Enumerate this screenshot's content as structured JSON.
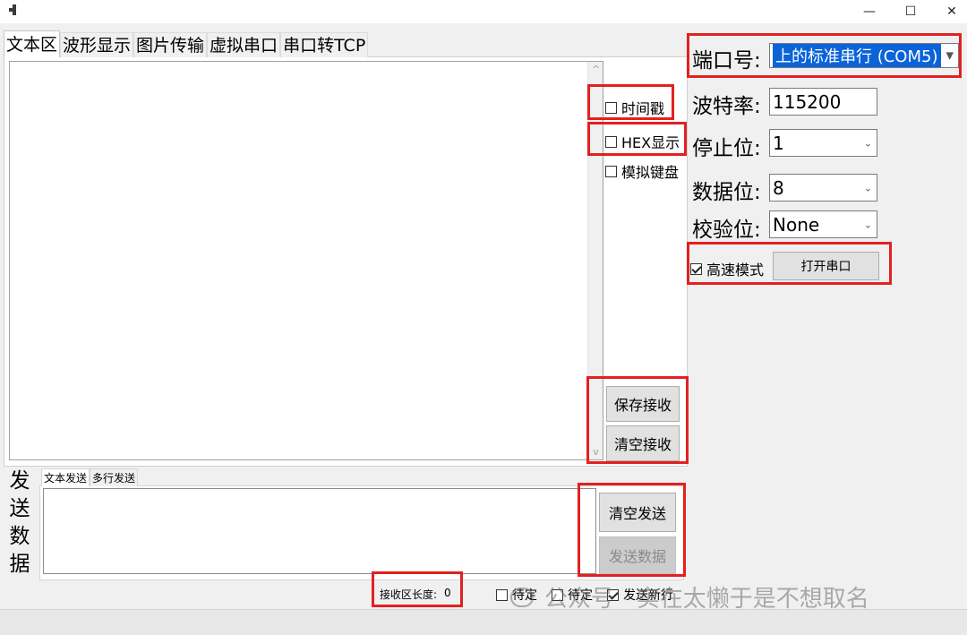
{
  "window": {
    "minimize_glyph": "—",
    "maximize_glyph": "☐",
    "close_glyph": "✕"
  },
  "tabs": [
    {
      "label": "文本区"
    },
    {
      "label": "波形显示"
    },
    {
      "label": "图片传输"
    },
    {
      "label": "虚拟串口"
    },
    {
      "label": "串口转TCP"
    }
  ],
  "receive": {
    "timestamp_label": "时间戳",
    "hex_label": "HEX显示",
    "keyboard_label": "模拟键盘",
    "save_button": "保存接收",
    "clear_button": "清空接收",
    "scroll_up": "^",
    "scroll_down": "v"
  },
  "settings": {
    "port_label": "端口号:",
    "port_value": "上的标准串行 (COM5)",
    "baud_label": "波特率:",
    "baud_value": "115200",
    "stop_label": "停止位:",
    "stop_value": "1",
    "data_label": "数据位:",
    "data_value": "8",
    "parity_label": "校验位:",
    "parity_value": "None",
    "highspeed_label": "高速模式",
    "highspeed_checked": true,
    "open_button": "打开串口"
  },
  "send": {
    "side_label": [
      "发",
      "送",
      "数",
      "据"
    ],
    "tab_text": "文本发送",
    "tab_multi": "多行发送",
    "clear_button": "清空发送",
    "send_button": "发送数据",
    "recv_len_label": "接收区长度:",
    "recv_len_value": "0",
    "pending1": "待定",
    "pending2": "待定",
    "newline_label": "发送新行"
  },
  "watermark": "公众号 · 实在太懒于是不想取名",
  "colors": {
    "highlight": "#e32020",
    "selection": "#0a64d8"
  }
}
